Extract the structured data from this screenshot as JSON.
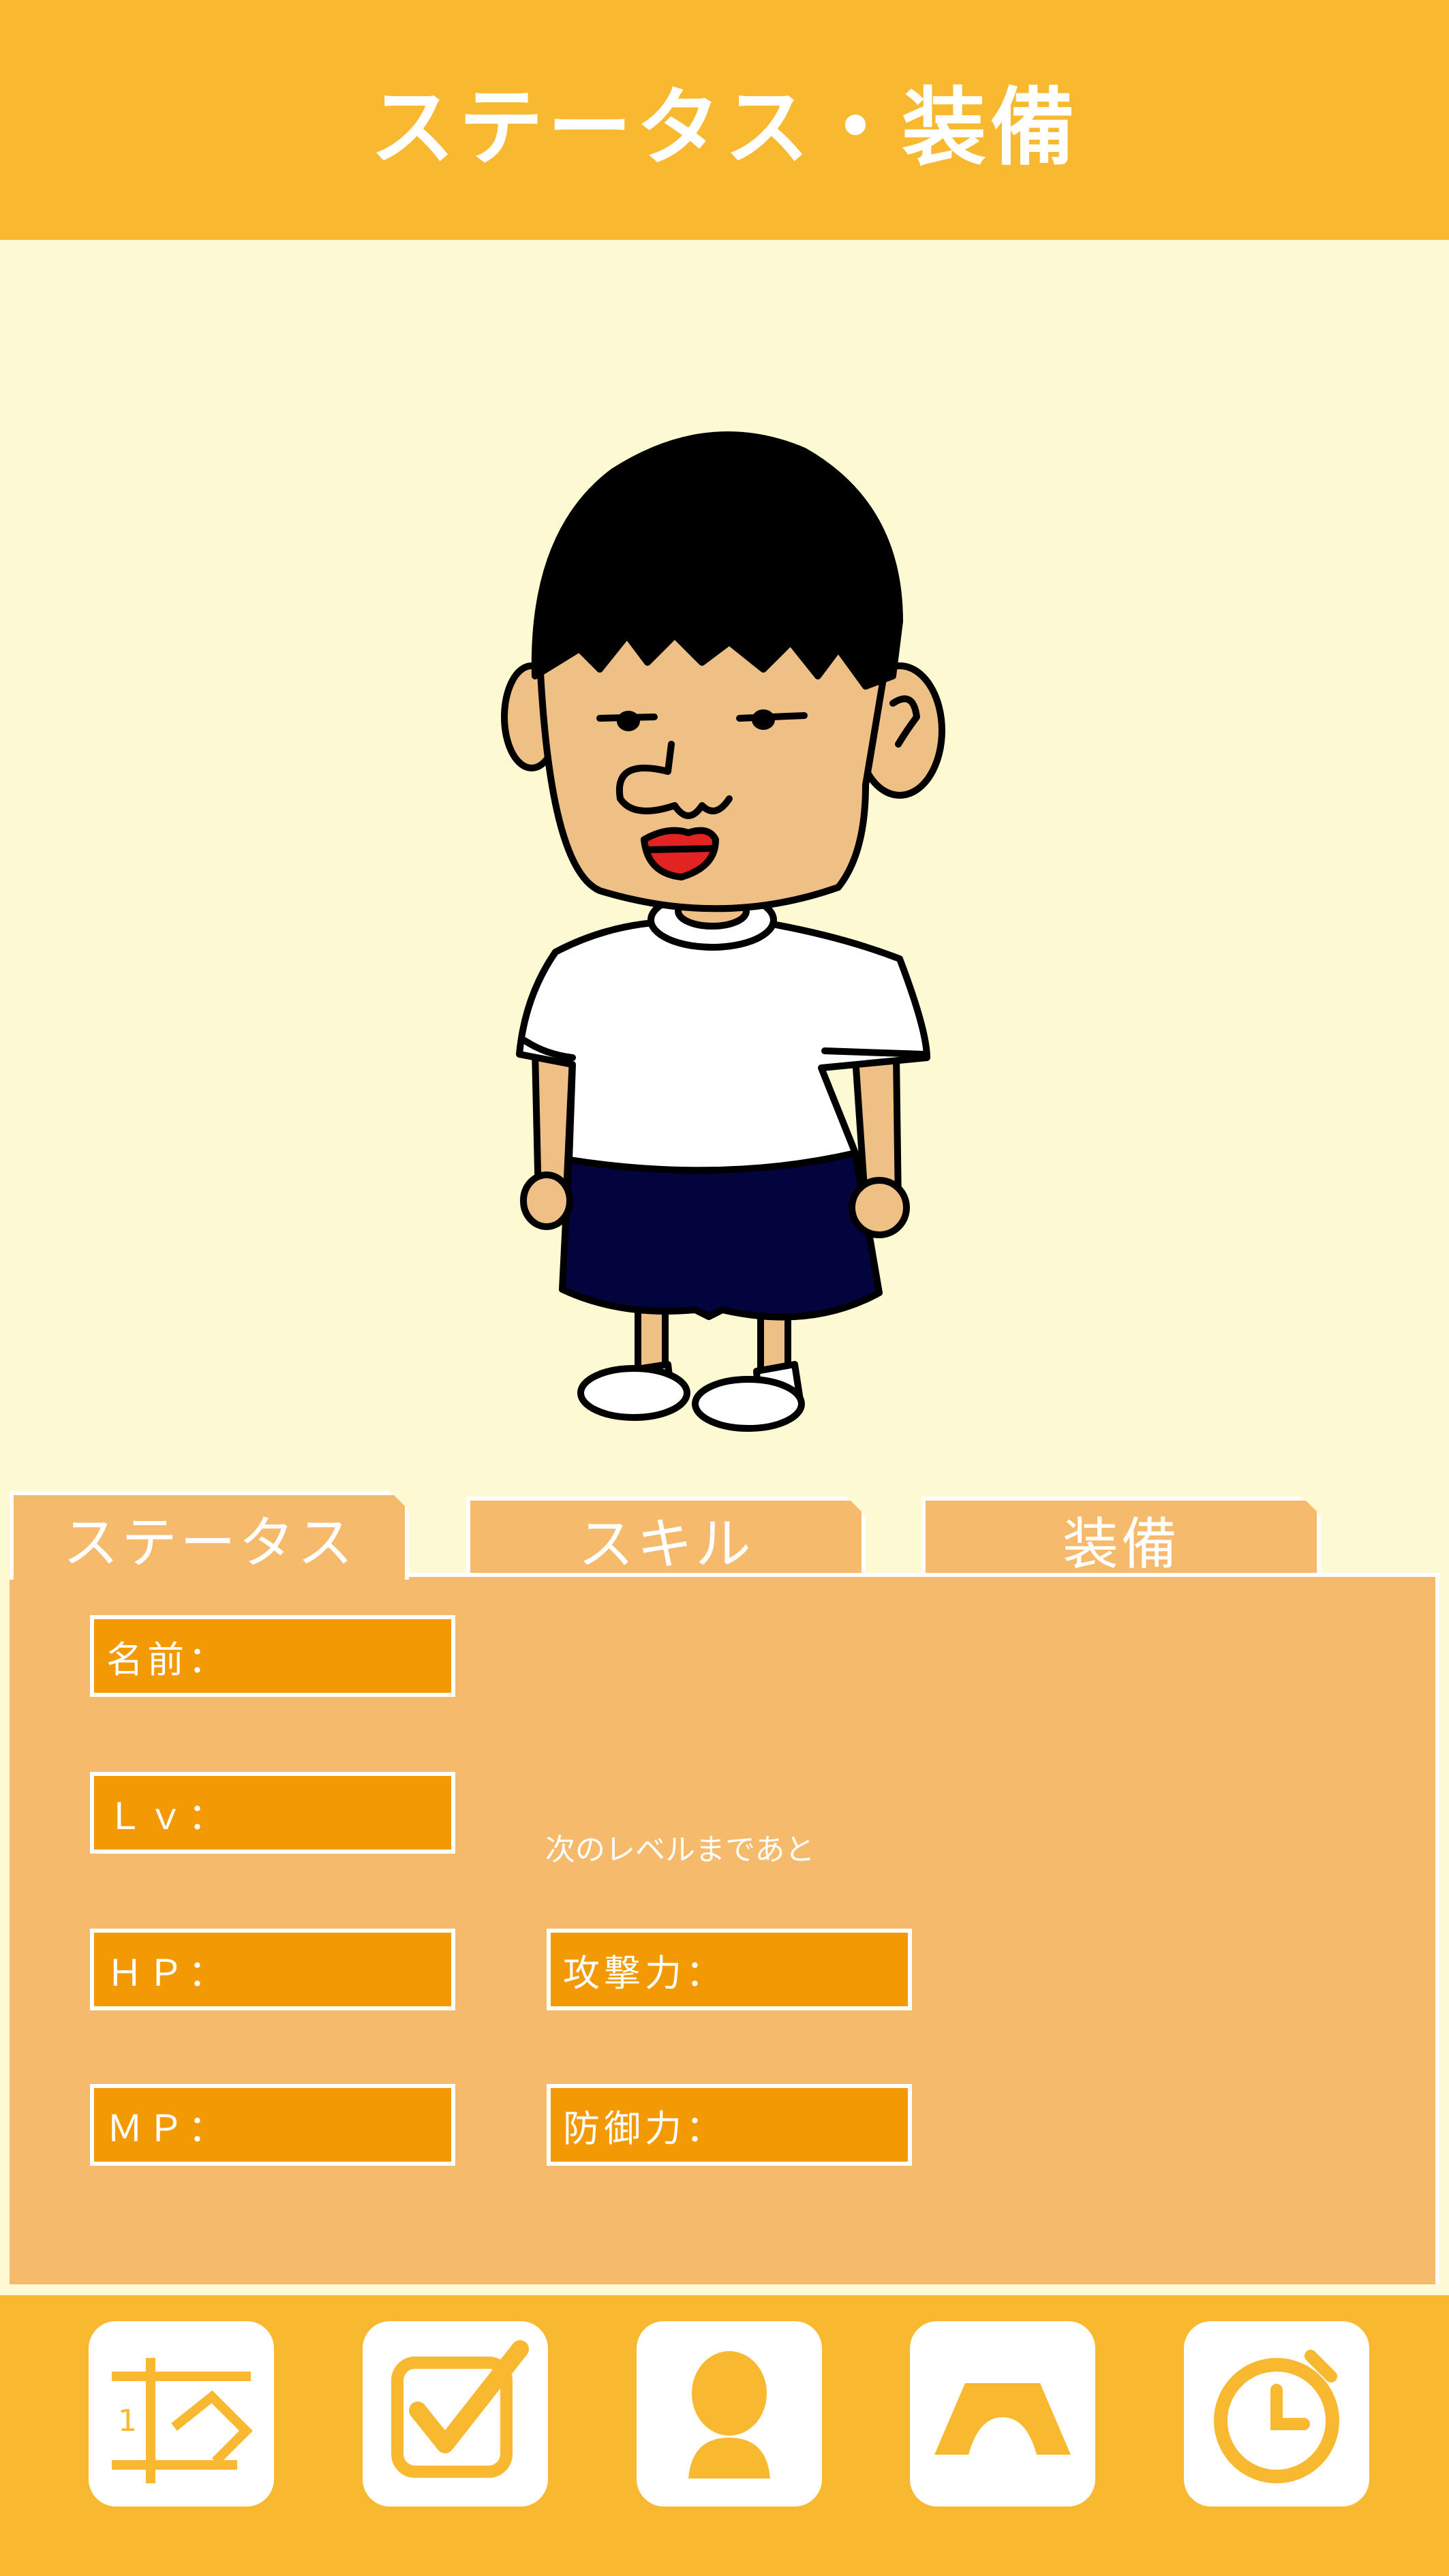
{
  "header": {
    "title": "ステータス・装備"
  },
  "tabs": [
    {
      "label": "ステータス",
      "active": true
    },
    {
      "label": "スキル",
      "active": false
    },
    {
      "label": "装備",
      "active": false
    }
  ],
  "status": {
    "name_label": "名前：",
    "lv_label": "Ｌｖ：",
    "next_level_text": "次のレベルまであと",
    "hp_label": "ＨＰ：",
    "attack_label": "攻撃力：",
    "mp_label": "ＭＰ：",
    "defense_label": "防御力："
  },
  "footer": {
    "buttons": [
      {
        "icon": "calendar-icon"
      },
      {
        "icon": "checkbox-icon"
      },
      {
        "icon": "person-icon"
      },
      {
        "icon": "tent-icon"
      },
      {
        "icon": "stopwatch-icon"
      }
    ],
    "calendar_number": "1"
  },
  "colors": {
    "header_bg": "#f8b830",
    "stage_bg": "#fdf9d3",
    "panel_bg": "#f5ba6c",
    "field_bg": "#f39904",
    "footer_bg": "#f8b830",
    "icon_color": "#f8b830"
  }
}
